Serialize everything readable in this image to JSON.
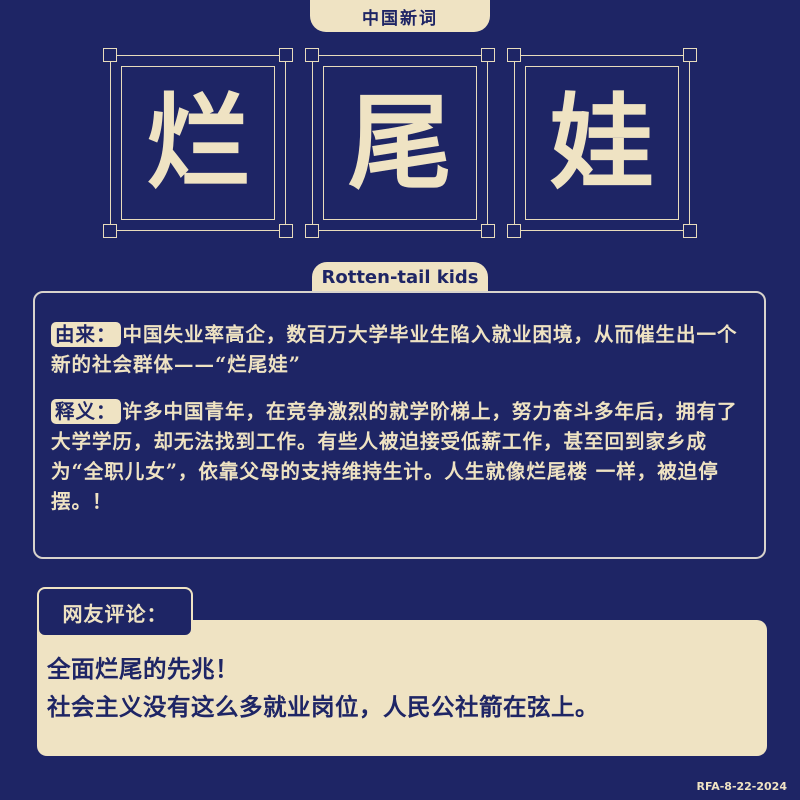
{
  "header": {
    "label": "中国新词"
  },
  "title_chars": [
    "烂",
    "尾",
    "娃"
  ],
  "subtitle": "Rotten-tail kids",
  "origin": {
    "tag": "由来：",
    "text": "中国失业率高企，数百万大学毕业生陷入就业困境，从而催生出一个新的社会群体——“烂尾娃”"
  },
  "meaning": {
    "tag": "释义：",
    "text": "许多中国青年，在竞争激烈的就学阶梯上，努力奋斗多年后，拥有了大学学历，却无法找到工作。有些人被迫接受低薪工作，甚至回到家乡成为“全职儿女”，依靠父母的支持维持生计。人生就像烂尾楼 一样，被迫停摆。！"
  },
  "comments": {
    "label": "网友评论：",
    "lines": [
      "全面烂尾的先兆！",
      "社会主义没有这么多就业岗位，人民公社箭在弦上。"
    ]
  },
  "footer": {
    "code": "RFA-8-22-2024"
  },
  "colors": {
    "navy": "#1e2565",
    "cream": "#efe3c3",
    "border": "#d8d3cc"
  }
}
